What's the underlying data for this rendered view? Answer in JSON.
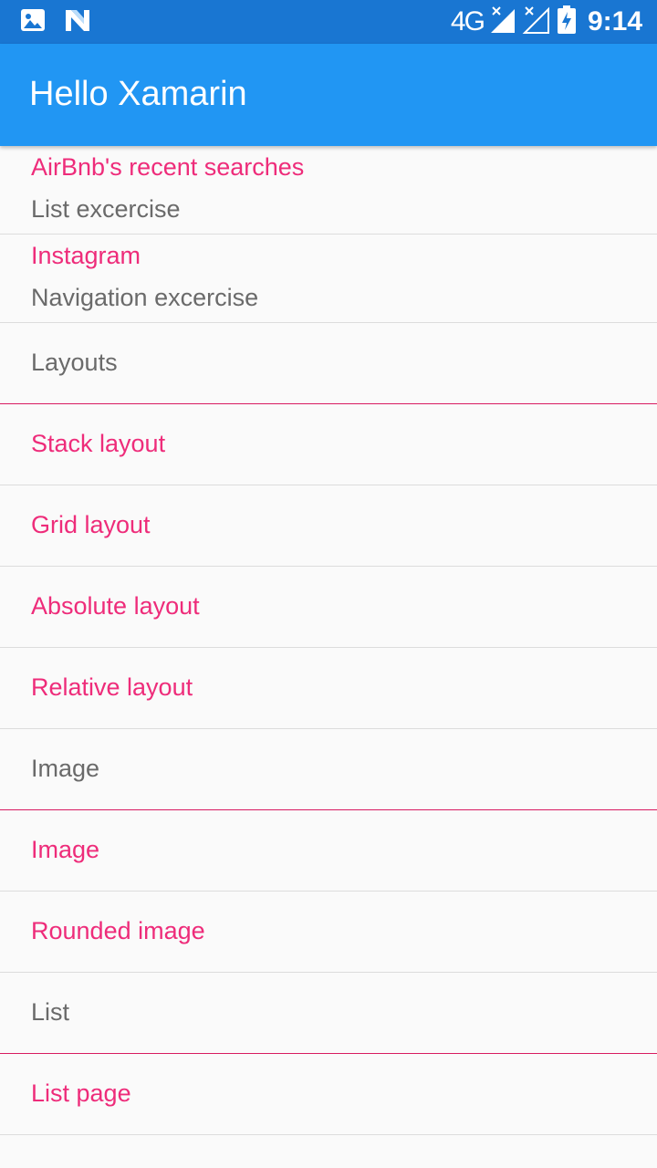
{
  "status_bar": {
    "left_icons": [
      "image-notification-icon",
      "n-logo-notification-icon"
    ],
    "network_type": "4G",
    "right_icons": [
      "cell-signal-no-data-icon",
      "cell-signal-empty-icon",
      "battery-charging-icon"
    ],
    "time": "9:14"
  },
  "app_bar": {
    "title": "Hello Xamarin",
    "color": "#2196f3"
  },
  "colors": {
    "accent": "#ee2c7a",
    "secondary_text": "#6a6a6a",
    "status_bar": "#1976d2",
    "header_divider": "#d81b60"
  },
  "list": {
    "item_1": {
      "title": "AirBnb's recent searches",
      "subtitle": "List excercise"
    },
    "item_2": {
      "title": "Instagram",
      "subtitle": "Navigation excercise"
    },
    "group_layouts": {
      "header": "Layouts",
      "items": [
        "Stack layout",
        "Grid layout",
        "Absolute layout",
        "Relative layout"
      ]
    },
    "group_image": {
      "header": "Image",
      "items": [
        "Image",
        "Rounded image"
      ]
    },
    "group_list": {
      "header": "List",
      "items": [
        "List page"
      ]
    }
  }
}
